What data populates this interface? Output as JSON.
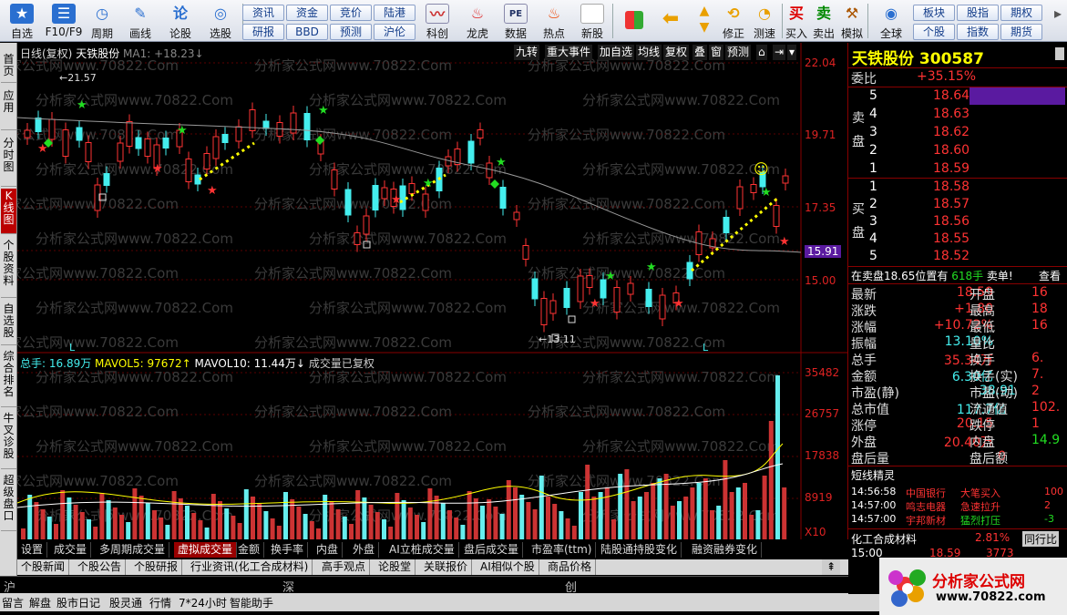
{
  "toolbar": {
    "items": [
      {
        "label": "自选"
      },
      {
        "label": "F10/F9"
      },
      {
        "label": "周期"
      },
      {
        "label": "画线"
      },
      {
        "label": "论股"
      },
      {
        "label": "选股"
      }
    ],
    "news_buttons": [
      [
        "资讯",
        "资金",
        "竞价",
        "陆港"
      ],
      [
        "研报",
        "BBD",
        "预测",
        "沪伦"
      ]
    ],
    "items2": [
      {
        "label": "科创"
      },
      {
        "label": "龙虎"
      },
      {
        "label": "数据"
      },
      {
        "label": "热点"
      },
      {
        "label": "新股"
      }
    ],
    "items3": [
      {
        "label": "向上"
      },
      {
        "label": "修正"
      },
      {
        "label": "测速"
      },
      {
        "label": "买入"
      },
      {
        "label": "卖出"
      },
      {
        "label": "模拟"
      },
      {
        "label": "全球"
      }
    ],
    "right_buttons": [
      [
        "板块",
        "股指",
        "期权"
      ],
      [
        "个股",
        "指数",
        "期货"
      ]
    ]
  },
  "left_tabs": [
    "首页",
    "应用",
    "分时图",
    "K线图",
    "个股资料",
    "自选股",
    "综合排名",
    "牛叉诊股",
    "超级盘口"
  ],
  "chart": {
    "info_label": "日线(复权)",
    "stock_name": "天铁股份",
    "ma_text": "MA1: +18.23↓",
    "tools": [
      "九转",
      "重大事件",
      "加自选",
      "均线",
      "复权",
      "叠",
      "窗",
      "预测"
    ],
    "y_labels": [
      "22.04",
      "19.71",
      "17.35",
      "15.91",
      "15.00"
    ],
    "high_label": "21.57",
    "low_label": "13.11",
    "L_marks": [
      "L",
      "L"
    ],
    "vol_title": "总手: 16.89万",
    "mavol5": "MAVOL5: 97672↑",
    "mavol10": "MAVOL10: 11.44万↓",
    "vol_note": "成交量已复权",
    "vol_labels": [
      "35482",
      "26757",
      "17838",
      "8919",
      "X10"
    ],
    "watermark": "分析家公式网www.70822.Com"
  },
  "bottom_tabs": [
    "设置",
    "成交量",
    "多周期成交量",
    "虚拟成交量",
    "金额",
    "换手率",
    "内盘",
    "外盘",
    "AI立桩成交量",
    "盘后成交量",
    "市盈率(ttm)",
    "陆股通持股变化",
    "融资融券变化"
  ],
  "bottom_tabs2": [
    "个股新闻",
    "个股公告",
    "个股研报",
    "行业资讯(化工合成材料)",
    "高手观点",
    "论股堂",
    "关联报价",
    "AI相似个股",
    "商品价格"
  ],
  "market_bar": [
    "沪",
    "深",
    "创",
    "中小"
  ],
  "status_bar": [
    "留言",
    "解盘",
    "股市日记",
    "股灵通",
    "行情",
    "7*24小时",
    "智能助手"
  ],
  "right_panel": {
    "title": "天铁股份",
    "code": "300587",
    "weibi_label": "委比",
    "weibi_value": "+35.15%",
    "sell": [
      {
        "n": "5",
        "p": "18.64"
      },
      {
        "n": "4",
        "p": "18.63"
      },
      {
        "n": "3",
        "p": "18.62"
      },
      {
        "n": "2",
        "p": "18.60"
      },
      {
        "n": "1",
        "p": "18.59"
      }
    ],
    "buy": [
      {
        "n": "1",
        "p": "18.58"
      },
      {
        "n": "2",
        "p": "18.57"
      },
      {
        "n": "3",
        "p": "18.56"
      },
      {
        "n": "4",
        "p": "18.55"
      },
      {
        "n": "5",
        "p": "18.52"
      }
    ],
    "sell_label": "卖盘",
    "buy_label": "买盘",
    "alert": "在卖盘18.65位置有",
    "alert_vol": "618手",
    "alert_tag": "卖单!",
    "alert_link": "查看",
    "stats": [
      {
        "k": "最新",
        "v": "18.59",
        "k2": "开盘",
        "v2": "16"
      },
      {
        "k": "涨跌",
        "v": "+1.80",
        "k2": "最高",
        "v2": "18"
      },
      {
        "k": "涨幅",
        "v": "+10.72%",
        "k2": "最低",
        "v2": "16"
      },
      {
        "k": "振幅",
        "v": "13.10%",
        "k2": "量比",
        "v2": ""
      },
      {
        "k": "总手",
        "v": "35.34万",
        "k2": "换手",
        "v2": "6."
      },
      {
        "k": "金额",
        "v": "6.30亿",
        "k2": "换手(实)",
        "v2": "7."
      },
      {
        "k": "市盈(静)",
        "v": "38.91",
        "k2": "市盈(动)",
        "v2": "2"
      },
      {
        "k": "总市值",
        "v": "117.7亿",
        "k2": "流通值",
        "v2": "102."
      },
      {
        "k": "涨停",
        "v": "20.15",
        "k2": "跌停",
        "v2": "1"
      },
      {
        "k": "外盘",
        "v": "20.40万",
        "k2": "内盘",
        "v2": "14.9"
      },
      {
        "k": "盘后量",
        "v": "0",
        "k2": "盘后额",
        "v2": ""
      }
    ],
    "short_title": "短线精灵",
    "short": [
      {
        "t": "14:56:58",
        "n": "中国银行",
        "e": "大笔买入",
        "v": "100"
      },
      {
        "t": "14:57:00",
        "n": "鸣志电器",
        "e": "急速拉升",
        "v": "2"
      },
      {
        "t": "14:57:00",
        "n": "宇邦新材",
        "e": "猛烈打压",
        "v": "-3"
      }
    ],
    "industry": "化工合成材料",
    "industry_pct": "2.81%",
    "industry_tag": "同行比",
    "time": "15:00",
    "last_price": "18.59",
    "last_vol": "3773"
  },
  "logo": {
    "text": "分析家公式网",
    "url": "www.70822.com"
  }
}
